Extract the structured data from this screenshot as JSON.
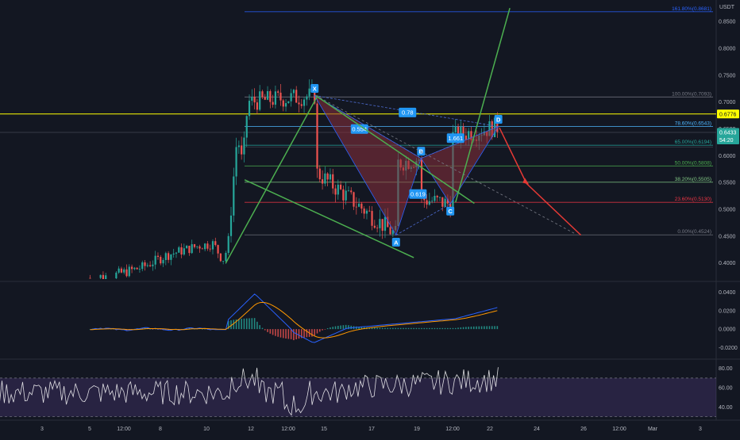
{
  "chart_data": {
    "type": "candlestick",
    "title": "",
    "currency_label": "USDT",
    "price_axis": {
      "ylim": [
        0.37,
        0.89
      ],
      "ticks": [
        0.4,
        0.45,
        0.5,
        0.55,
        0.6,
        0.65,
        0.7,
        0.75,
        0.8,
        0.85
      ],
      "tick_labels": [
        "0.4000",
        "0.4500",
        "0.5000",
        "0.5500",
        "0.6000",
        "0.6500",
        "0.7000",
        "0.7500",
        "0.8000",
        "0.8500"
      ]
    },
    "price_badges": [
      {
        "label": "0.6776",
        "value": 0.6776,
        "color": "#ffff00",
        "text_color": "#131722"
      },
      {
        "label": "0.6433",
        "value": 0.6433,
        "color": "#26a69a",
        "text_color": "#ffffff"
      },
      {
        "label": "54:20",
        "value": 0.6293,
        "color": "#26a69a",
        "text_color": "#ffffff"
      }
    ],
    "time_axis": {
      "labels": [
        "3",
        "5",
        "12:00",
        "8",
        "10",
        "12",
        "12:00",
        "15",
        "17",
        "19",
        "12:00",
        "22",
        "24",
        "26",
        "12:00",
        "Mar",
        "3"
      ]
    },
    "fibonacci": [
      {
        "label": "161.80%(0.8681)",
        "value": 0.8681,
        "color": "#2962ff"
      },
      {
        "label": "100.00%(0.7093)",
        "value": 0.7093,
        "color": "#787b86"
      },
      {
        "label": "78.60%(0.6543)",
        "value": 0.6543,
        "color": "#4db6ff"
      },
      {
        "label": "65.00%(0.6194)",
        "value": 0.6194,
        "color": "#26a69a"
      },
      {
        "label": "50.00%(0.5808)",
        "value": 0.5808,
        "color": "#4caf50"
      },
      {
        "label": "38.20%(0.5505)",
        "value": 0.5505,
        "color": "#81c784"
      },
      {
        "label": "23.60%(0.5130)",
        "value": 0.513,
        "color": "#f23645"
      },
      {
        "label": "0.00%(0.4524)",
        "value": 0.4524,
        "color": "#787b86"
      }
    ],
    "pattern": {
      "points": [
        {
          "name": "X",
          "t": 16.05,
          "price": 0.712
        },
        {
          "name": "A",
          "t": 19.95,
          "price": 0.452
        },
        {
          "name": "B",
          "t": 21.15,
          "price": 0.595
        },
        {
          "name": "C",
          "t": 22.55,
          "price": 0.51
        },
        {
          "name": "D",
          "t": 24.85,
          "price": 0.6543
        }
      ],
      "ratios": [
        {
          "label": "0.554",
          "t": 18.2,
          "price": 0.6495
        },
        {
          "label": "0.619",
          "t": 21.0,
          "price": 0.5285
        },
        {
          "label": "1.661",
          "t": 22.8,
          "price": 0.6325
        },
        {
          "label": "0.78",
          "t": 20.5,
          "price": 0.6805
        }
      ]
    },
    "macd": {
      "ticks": [
        0.04,
        0.02,
        0.0,
        -0.02
      ],
      "tick_labels": [
        "0.0400",
        "0.0200",
        "0.0000",
        "-0.0200"
      ]
    },
    "rsi": {
      "ticks": [
        80,
        60,
        40
      ],
      "tick_labels": [
        "80.00",
        "60.00",
        "40.00"
      ],
      "band": [
        30,
        70
      ]
    },
    "colors": {
      "up": "#26a69a",
      "down": "#ef5350",
      "pattern_fill": "#8b2f3c",
      "trend_green": "#4caf50",
      "target_red": "#e53935",
      "macd_line": "#2962ff",
      "signal_line": "#ff9800",
      "rsi_line": "#ffffff",
      "rsi_band": "#7e57c2"
    }
  }
}
